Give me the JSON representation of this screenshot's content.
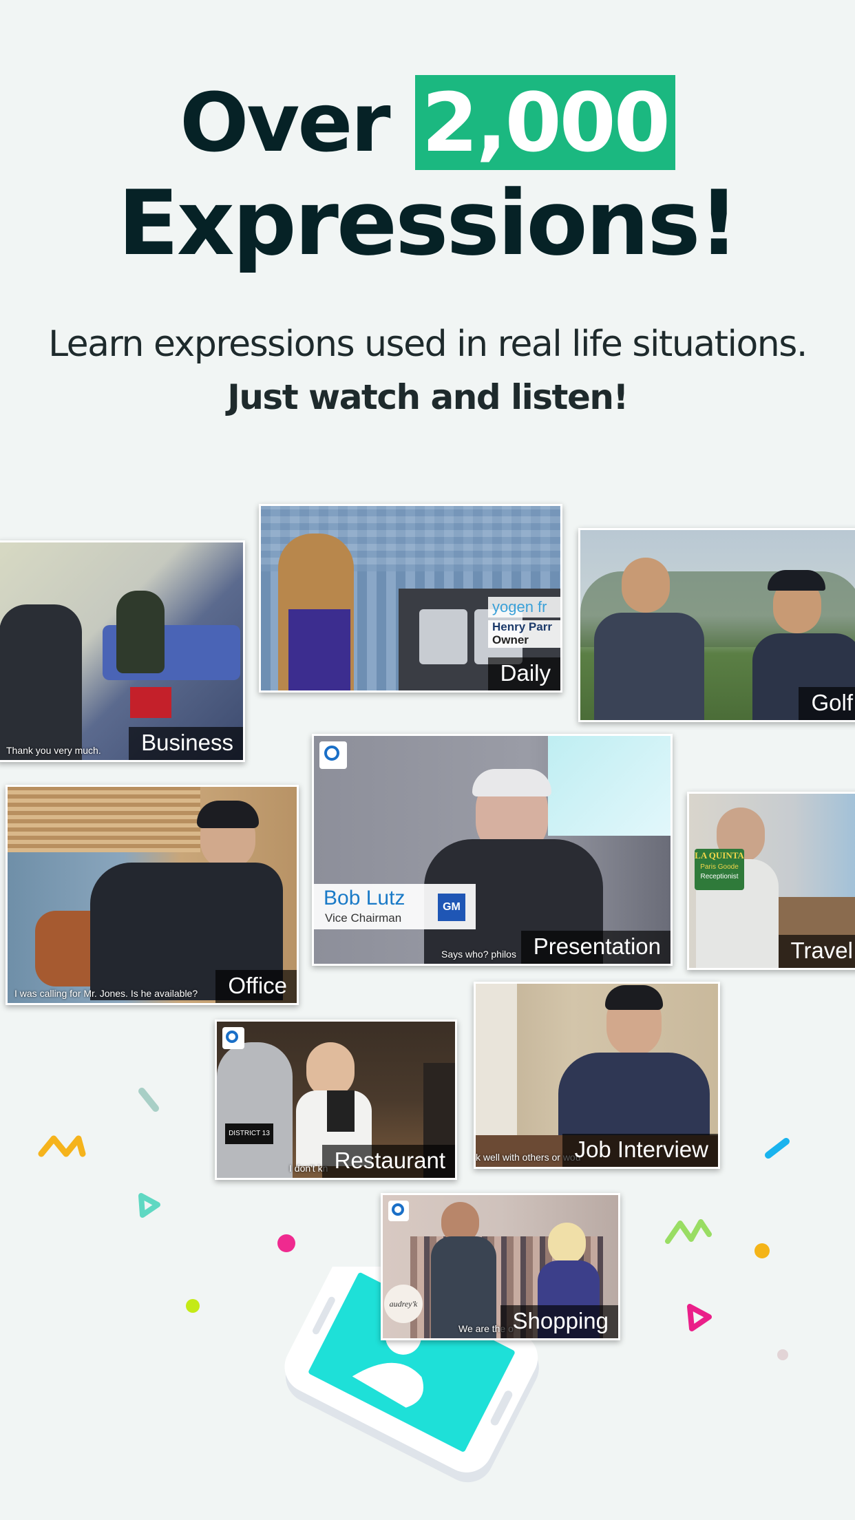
{
  "headline": {
    "prefix": "Over ",
    "highlight": "2,000",
    "line2": "Expressions!"
  },
  "subtitle": {
    "line1": "Learn expressions used in real life situations.",
    "line2": "Just watch and listen!"
  },
  "cards": [
    {
      "id": "business",
      "label": "Business",
      "caption": "Thank you very much."
    },
    {
      "id": "daily",
      "label": "Daily",
      "sign": "yogen fr",
      "name_tag_name": "Henry Parr",
      "name_tag_title": "Owner"
    },
    {
      "id": "golf",
      "label": "Golf"
    },
    {
      "id": "office",
      "label": "Office",
      "caption": "I was calling for Mr. Jones. Is he available?"
    },
    {
      "id": "presentation",
      "label": "Presentation",
      "name_tag_name": "Bob Lutz",
      "name_tag_title": "Vice Chairman",
      "logo": "GM",
      "caption": "Says who? philos"
    },
    {
      "id": "travel",
      "label": "Travel",
      "hotel_logo": "LA QUINTA",
      "name_tag_name": "Paris Goode",
      "name_tag_title": "Receptionist"
    },
    {
      "id": "restaurant",
      "label": "Restaurant",
      "sign": "DISTRICT 13",
      "caption": "I don't kn"
    },
    {
      "id": "job-interview",
      "label": "Job Interview",
      "caption": "k well with others or wou"
    },
    {
      "id": "shopping",
      "label": "Shopping",
      "sign": "audrey'k",
      "caption": "We are the o"
    }
  ],
  "colors": {
    "accent": "#1bb880",
    "headline": "#062226",
    "phone_screen": "#1ee0d8"
  }
}
